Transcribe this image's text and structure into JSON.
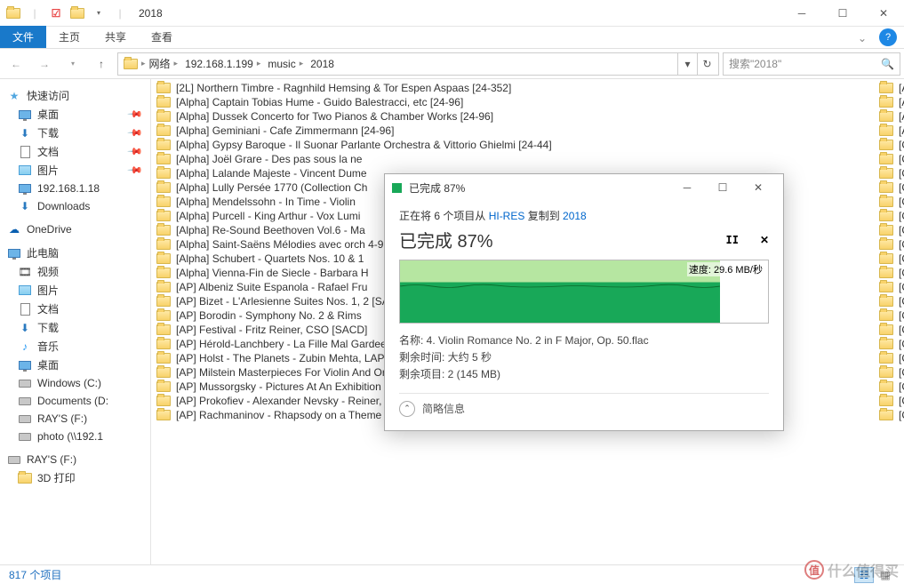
{
  "window": {
    "title": "2018"
  },
  "ribbon": {
    "file": "文件",
    "tabs": [
      "主页",
      "共享",
      "查看"
    ]
  },
  "breadcrumb": {
    "segs": [
      "网络",
      "192.168.1.199",
      "music",
      "2018"
    ]
  },
  "search": {
    "placeholder": "搜索\"2018\""
  },
  "nav": {
    "quick": "快速访问",
    "quick_items": [
      "桌面",
      "下载",
      "文档",
      "图片",
      "192.168.1.18",
      "Downloads"
    ],
    "onedrive": "OneDrive",
    "pc": "此电脑",
    "pc_items": [
      "视频",
      "图片",
      "文档",
      "下载",
      "音乐",
      "桌面",
      "Windows (C:)",
      "Documents (D:",
      "RAY'S (F:)",
      "photo (\\\\192.1"
    ],
    "rays": "RAY'S (F:)",
    "rays_items": [
      "3D 打印"
    ]
  },
  "files": [
    "[2L] Northern Timbre - Ragnhild Hemsing & Tor Espen Aspaas [24-352]",
    "[Alpha] Captain Tobias Hume - Guido Balestracci, etc [24-96]",
    "[Alpha] Dussek Concerto for Two Pianos & Chamber Works  [24-96]",
    "[Alpha] Geminiani - Cafe Zimmermann [24-96]",
    "[Alpha] Gypsy Baroque - Il Suonar Parlante Orchestra & Vittorio Ghielmi [24-44]",
    "[Alpha] Joël Grare - Des pas sous la ne",
    "[Alpha] Lalande Majeste - Vincent Dume",
    "[Alpha] Lully Persée 1770 (Collection Ch",
    "[Alpha] Mendelssohn - In Time - Violin",
    "[Alpha] Purcell - King Arthur - Vox Lumi",
    "[Alpha] Re-Sound Beethoven Vol.6 - Ma",
    "[Alpha] Saint-Saëns Mélodies avec orch                                                                                                     4-96]",
    "[Alpha] Schubert - Quartets Nos. 10 & 1",
    "[Alpha] Vienna-Fin de Siecle - Barbara H",
    "[AP] Albeniz Suite Espanola - Rafael Fru",
    "[AP] Bizet - L'Arlesienne Suites Nos. 1, 2                                                                                                    [SACD]",
    "[AP] Borodin - Symphony No. 2 & Rims",
    "[AP] Festival - Fritz Reiner, CSO [SACD]",
    "[AP] Hérold-Lanchbery - La Fille Mal Gardee - John Lanchbery [SACD]",
    "[AP] Holst - The Planets - Zubin Mehta, LAPO [SACD]",
    "[AP] Milstein Masterpieces For Violin And Orchestra - Nathan Milstein [SACD]",
    "[AP] Mussorgsky - Pictures At An Exhibition - Fritz Reiner, CSO [SACD]",
    "[AP] Prokofiev - Alexander Nevsky - Reiner, CSO [SACD]",
    "[AP] Rachmaninov - Rhapsody on a Theme of Paganini & Falla- Noches en los Jardines de Espana - Arthur Rubinstein [SACD]"
  ],
  "right_stubs": [
    "[A",
    "[A",
    "[A",
    "[A",
    "[C",
    "[C",
    "[C",
    "[C",
    "[C",
    "[C",
    "[C",
    "[C",
    "[C",
    "[C",
    "[C",
    "[C",
    "[C",
    "[C",
    "[C",
    "[C",
    "[C",
    "[C",
    "[C",
    "[C"
  ],
  "status": {
    "count": "817 个项目"
  },
  "dialog": {
    "title": "已完成 87%",
    "copying_prefix": "正在将 6 个项目从 ",
    "src": "HI-RES",
    "mid": " 复制到 ",
    "dst": "2018",
    "progress": "已完成 87%",
    "speed": "速度: 29.6 MB/秒",
    "name_label": "名称: ",
    "name": "4. Violin Romance No. 2 in F Major, Op. 50.flac",
    "time_label": "剩余时间: ",
    "time": "大约 5 秒",
    "items_label": "剩余项目: ",
    "items": "2 (145 MB)",
    "less": "简略信息"
  },
  "chart_data": {
    "type": "area",
    "percent_complete": 87,
    "speed_mb_s": 29.6,
    "series": [
      {
        "name": "transfer speed",
        "values": [
          28,
          30,
          27,
          31,
          29,
          32,
          28,
          30,
          29,
          31,
          28,
          30
        ]
      }
    ],
    "ylabel": "MB/秒"
  },
  "watermark": "什么值得买"
}
